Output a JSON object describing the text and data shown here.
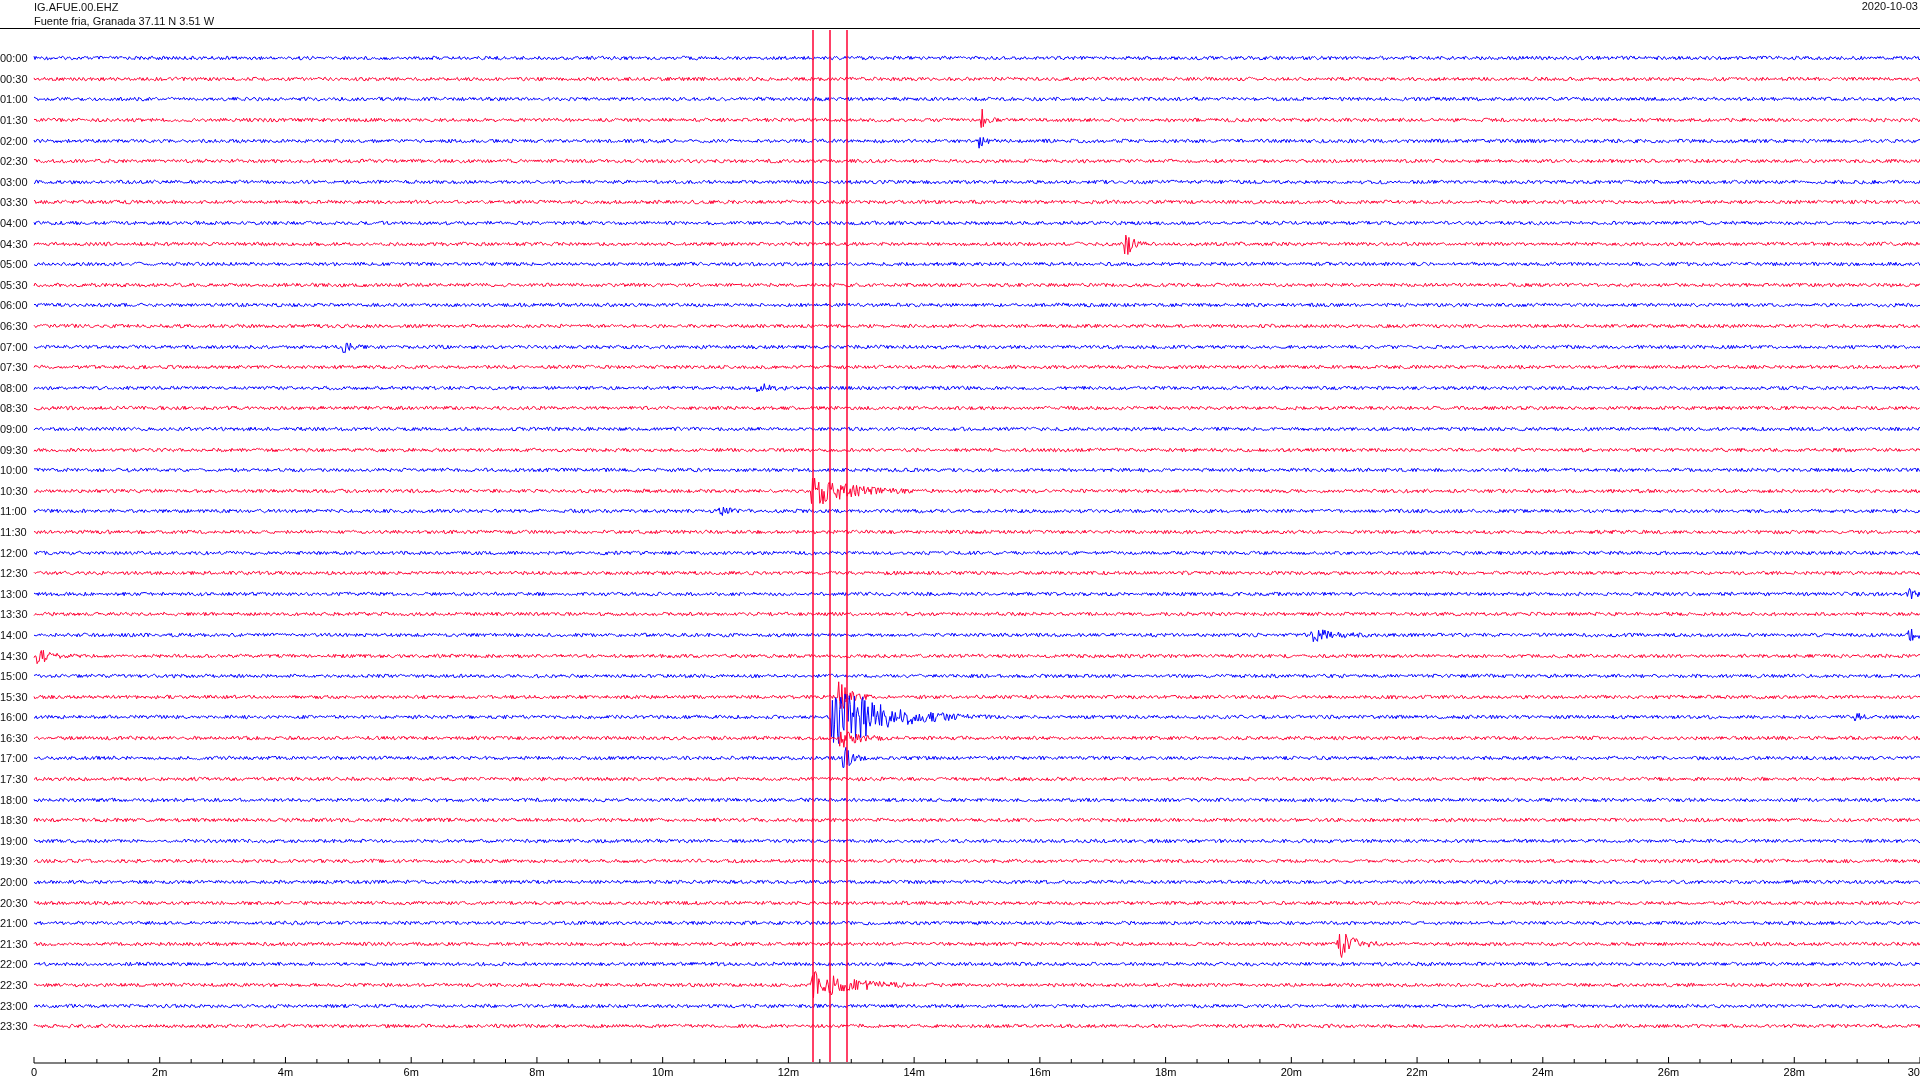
{
  "header": {
    "station": "IG.AFUE.00.EHZ",
    "location": "Fuente fria, Granada  37.11 N 3.51 W",
    "date": "2020-10-03"
  },
  "rows": [
    {
      "label": "00:00",
      "color": "#0000ff"
    },
    {
      "label": "00:30",
      "color": "#ff0033"
    },
    {
      "label": "01:00",
      "color": "#0000ff"
    },
    {
      "label": "01:30",
      "color": "#ff0033"
    },
    {
      "label": "02:00",
      "color": "#0000ff"
    },
    {
      "label": "02:30",
      "color": "#ff0033"
    },
    {
      "label": "03:00",
      "color": "#0000ff"
    },
    {
      "label": "03:30",
      "color": "#ff0033"
    },
    {
      "label": "04:00",
      "color": "#0000ff"
    },
    {
      "label": "04:30",
      "color": "#ff0033"
    },
    {
      "label": "05:00",
      "color": "#0000ff"
    },
    {
      "label": "05:30",
      "color": "#ff0033"
    },
    {
      "label": "06:00",
      "color": "#0000ff"
    },
    {
      "label": "06:30",
      "color": "#ff0033"
    },
    {
      "label": "07:00",
      "color": "#0000ff"
    },
    {
      "label": "07:30",
      "color": "#ff0033"
    },
    {
      "label": "08:00",
      "color": "#0000ff"
    },
    {
      "label": "08:30",
      "color": "#ff0033"
    },
    {
      "label": "09:00",
      "color": "#0000ff"
    },
    {
      "label": "09:30",
      "color": "#ff0033"
    },
    {
      "label": "10:00",
      "color": "#0000ff"
    },
    {
      "label": "10:30",
      "color": "#ff0033"
    },
    {
      "label": "11:00",
      "color": "#0000ff"
    },
    {
      "label": "11:30",
      "color": "#ff0033"
    },
    {
      "label": "12:00",
      "color": "#0000ff"
    },
    {
      "label": "12:30",
      "color": "#ff0033"
    },
    {
      "label": "13:00",
      "color": "#0000ff"
    },
    {
      "label": "13:30",
      "color": "#ff0033"
    },
    {
      "label": "14:00",
      "color": "#0000ff"
    },
    {
      "label": "14:30",
      "color": "#ff0033"
    },
    {
      "label": "15:00",
      "color": "#0000ff"
    },
    {
      "label": "15:30",
      "color": "#ff0033"
    },
    {
      "label": "16:00",
      "color": "#0000ff"
    },
    {
      "label": "16:30",
      "color": "#ff0033"
    },
    {
      "label": "17:00",
      "color": "#0000ff"
    },
    {
      "label": "17:30",
      "color": "#ff0033"
    },
    {
      "label": "18:00",
      "color": "#0000ff"
    },
    {
      "label": "18:30",
      "color": "#ff0033"
    },
    {
      "label": "19:00",
      "color": "#0000ff"
    },
    {
      "label": "19:30",
      "color": "#ff0033"
    },
    {
      "label": "20:00",
      "color": "#0000ff"
    },
    {
      "label": "20:30",
      "color": "#ff0033"
    },
    {
      "label": "21:00",
      "color": "#0000ff"
    },
    {
      "label": "21:30",
      "color": "#ff0033"
    },
    {
      "label": "22:00",
      "color": "#0000ff"
    },
    {
      "label": "22:30",
      "color": "#ff0033"
    },
    {
      "label": "23:00",
      "color": "#0000ff"
    },
    {
      "label": "23:30",
      "color": "#ff0033"
    }
  ],
  "x_axis": {
    "ticks": [
      "0",
      "2m",
      "4m",
      "6m",
      "8m",
      "10m",
      "12m",
      "14m",
      "16m",
      "18m",
      "20m",
      "22m",
      "24m",
      "26m",
      "28m",
      "30"
    ]
  }
}
